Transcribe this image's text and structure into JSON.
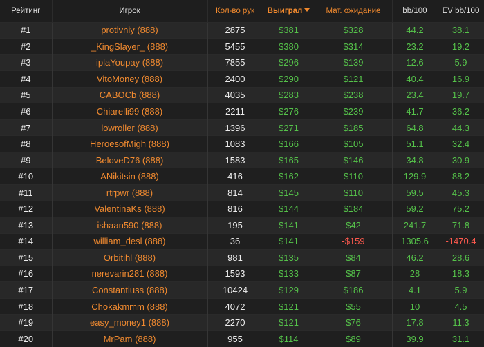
{
  "headers": {
    "rank": "Рейтинг",
    "player": "Игрок",
    "hands": "Кол-во рук",
    "won": "Выиграл",
    "expected": "Мат. ожидание",
    "bb100": "bb/100",
    "ev_bb100": "EV bb/100"
  },
  "colors": {
    "accent": "#f28a2e",
    "positive": "#55c24a",
    "negative": "#ff5a4e",
    "background": "#1e1e1e"
  },
  "rows": [
    {
      "rank": "#1",
      "player": "protivniy (888)",
      "hands": "2875",
      "won": "$381",
      "ev": "$328",
      "bb": "44.2",
      "evbb": "38.1"
    },
    {
      "rank": "#2",
      "player": "_KingSlayer_ (888)",
      "hands": "5455",
      "won": "$380",
      "ev": "$314",
      "bb": "23.2",
      "evbb": "19.2"
    },
    {
      "rank": "#3",
      "player": "iplaYoupay (888)",
      "hands": "7855",
      "won": "$296",
      "ev": "$139",
      "bb": "12.6",
      "evbb": "5.9"
    },
    {
      "rank": "#4",
      "player": "VitoMoney (888)",
      "hands": "2400",
      "won": "$290",
      "ev": "$121",
      "bb": "40.4",
      "evbb": "16.9"
    },
    {
      "rank": "#5",
      "player": "CABOCb (888)",
      "hands": "4035",
      "won": "$283",
      "ev": "$238",
      "bb": "23.4",
      "evbb": "19.7"
    },
    {
      "rank": "#6",
      "player": "Chiarelli99 (888)",
      "hands": "2211",
      "won": "$276",
      "ev": "$239",
      "bb": "41.7",
      "evbb": "36.2"
    },
    {
      "rank": "#7",
      "player": "lowroller (888)",
      "hands": "1396",
      "won": "$271",
      "ev": "$185",
      "bb": "64.8",
      "evbb": "44.3"
    },
    {
      "rank": "#8",
      "player": "HeroesofMigh (888)",
      "hands": "1083",
      "won": "$166",
      "ev": "$105",
      "bb": "51.1",
      "evbb": "32.4"
    },
    {
      "rank": "#9",
      "player": "BeloveD76 (888)",
      "hands": "1583",
      "won": "$165",
      "ev": "$146",
      "bb": "34.8",
      "evbb": "30.9"
    },
    {
      "rank": "#10",
      "player": "ANikitsin (888)",
      "hands": "416",
      "won": "$162",
      "ev": "$110",
      "bb": "129.9",
      "evbb": "88.2"
    },
    {
      "rank": "#11",
      "player": "rtrpwr (888)",
      "hands": "814",
      "won": "$145",
      "ev": "$110",
      "bb": "59.5",
      "evbb": "45.3"
    },
    {
      "rank": "#12",
      "player": "ValentinaKs (888)",
      "hands": "816",
      "won": "$144",
      "ev": "$184",
      "bb": "59.2",
      "evbb": "75.2"
    },
    {
      "rank": "#13",
      "player": "ishaan590 (888)",
      "hands": "195",
      "won": "$141",
      "ev": "$42",
      "bb": "241.7",
      "evbb": "71.8"
    },
    {
      "rank": "#14",
      "player": "william_desl (888)",
      "hands": "36",
      "won": "$141",
      "ev": "-$159",
      "bb": "1305.6",
      "evbb": "-1470.4"
    },
    {
      "rank": "#15",
      "player": "Orbitihl (888)",
      "hands": "981",
      "won": "$135",
      "ev": "$84",
      "bb": "46.2",
      "evbb": "28.6"
    },
    {
      "rank": "#16",
      "player": "nerevarin281 (888)",
      "hands": "1593",
      "won": "$133",
      "ev": "$87",
      "bb": "28",
      "evbb": "18.3"
    },
    {
      "rank": "#17",
      "player": "Constantiuss (888)",
      "hands": "10424",
      "won": "$129",
      "ev": "$186",
      "bb": "4.1",
      "evbb": "5.9"
    },
    {
      "rank": "#18",
      "player": "Chokakmmm (888)",
      "hands": "4072",
      "won": "$121",
      "ev": "$55",
      "bb": "10",
      "evbb": "4.5"
    },
    {
      "rank": "#19",
      "player": "easy_money1 (888)",
      "hands": "2270",
      "won": "$121",
      "ev": "$76",
      "bb": "17.8",
      "evbb": "11.3"
    },
    {
      "rank": "#20",
      "player": "MrPam (888)",
      "hands": "955",
      "won": "$114",
      "ev": "$89",
      "bb": "39.9",
      "evbb": "31.1"
    }
  ]
}
